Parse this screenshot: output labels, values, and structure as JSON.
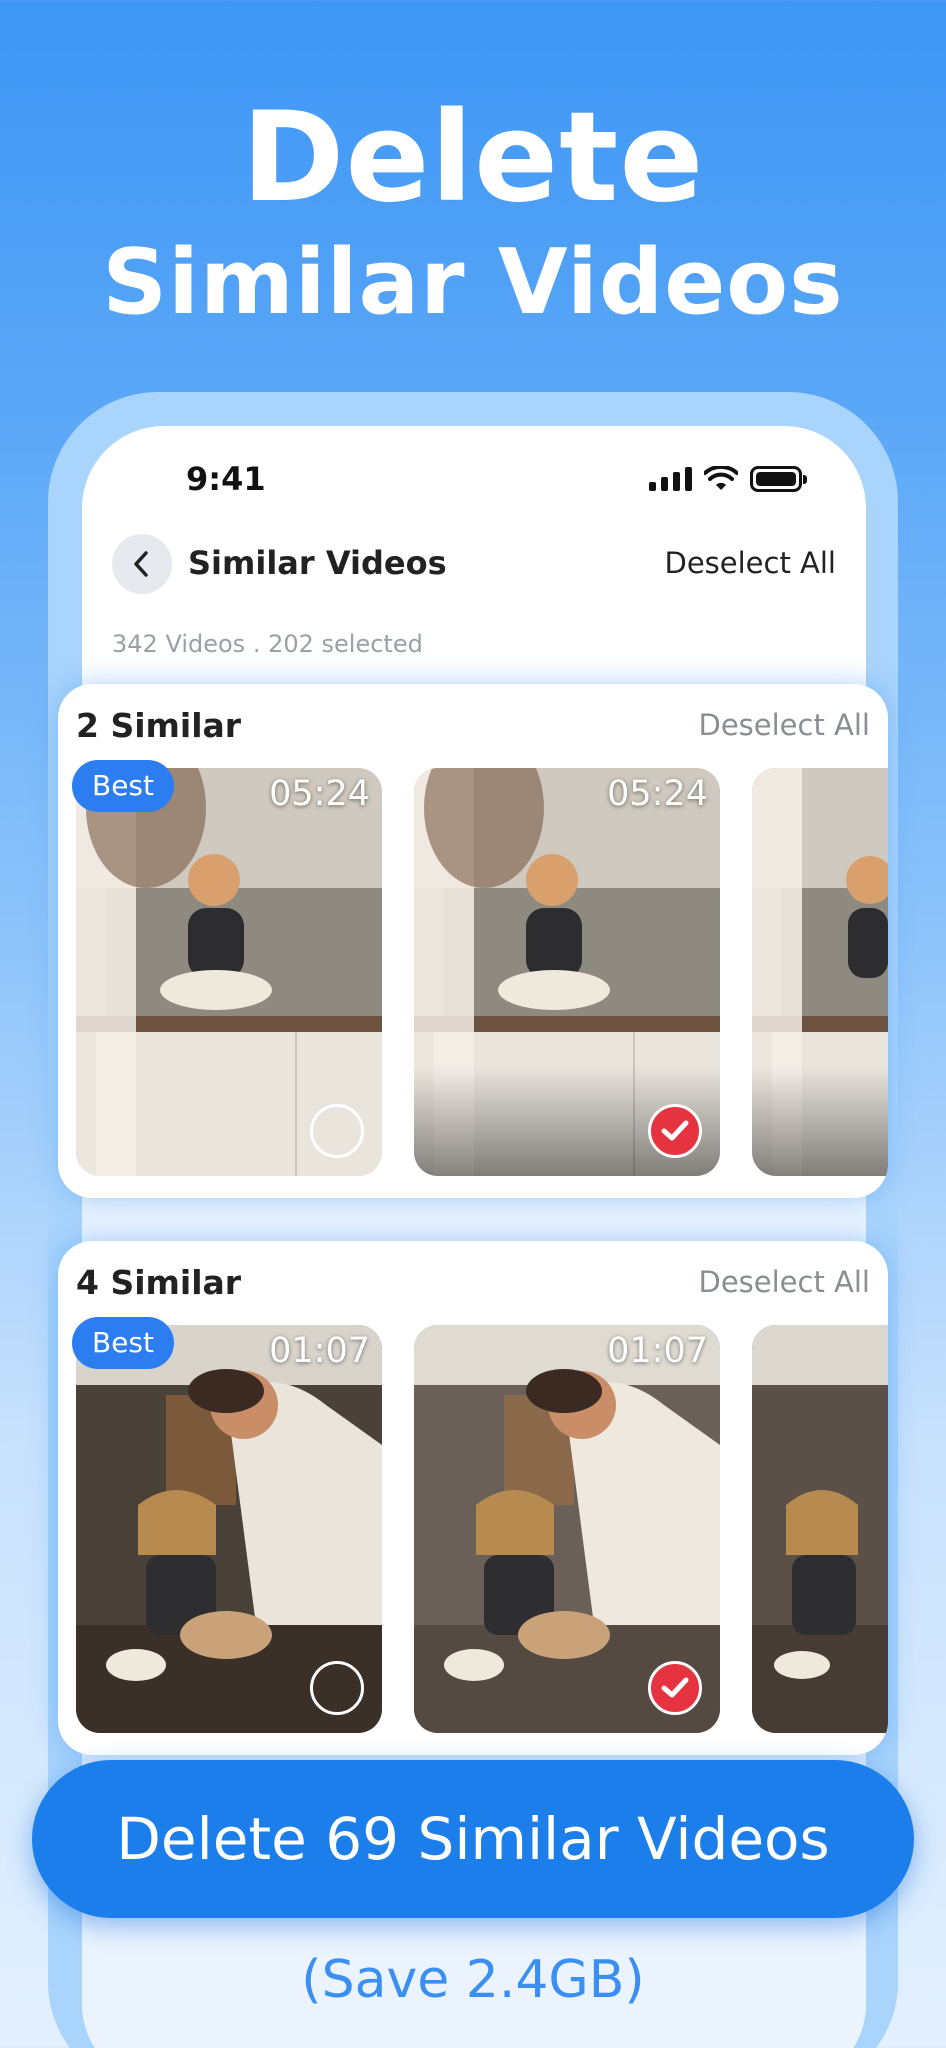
{
  "headline": {
    "line1": "Delete",
    "line2": "Similar Videos"
  },
  "status_bar": {
    "time": "9:41"
  },
  "nav": {
    "title": "Similar Videos",
    "deselect_all": "Deselect All"
  },
  "summary": "342 Videos . 202 selected",
  "groups": [
    {
      "title": "2 Similar",
      "deselect_label": "Deselect All",
      "best_badge": "Best",
      "videos": [
        {
          "duration": "05:24",
          "selected": false
        },
        {
          "duration": "05:24",
          "selected": true
        }
      ]
    },
    {
      "title": "4 Similar",
      "deselect_label": "Deselect All",
      "best_badge": "Best",
      "videos": [
        {
          "duration": "01:07",
          "selected": false
        },
        {
          "duration": "01:07",
          "selected": true
        }
      ]
    }
  ],
  "cta": {
    "label": "Delete 69 Similar Videos",
    "savings": "(Save 2.4GB)"
  },
  "colors": {
    "accent": "#1b7eeb",
    "check": "#e5343f",
    "badge": "#2b7df0"
  }
}
